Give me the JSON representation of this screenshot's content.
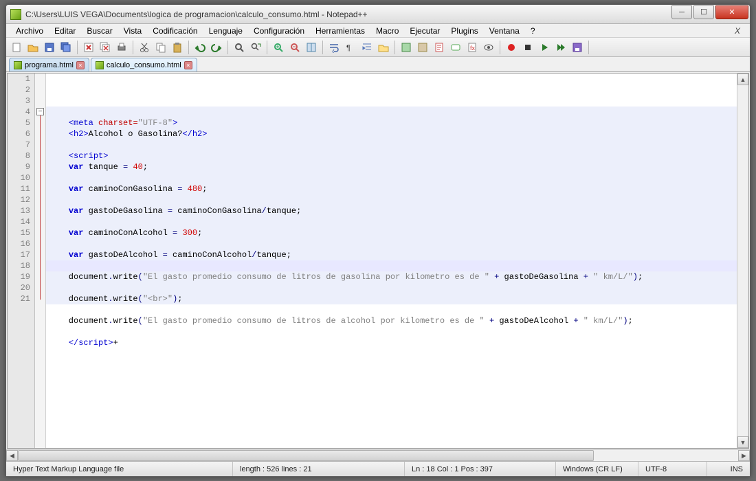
{
  "window": {
    "title": "C:\\Users\\LUIS VEGA\\Documents\\logica de programacion\\calculo_consumo.html - Notepad++"
  },
  "menu": {
    "items": [
      "Archivo",
      "Editar",
      "Buscar",
      "Vista",
      "Codificación",
      "Lenguaje",
      "Configuración",
      "Herramientas",
      "Macro",
      "Ejecutar",
      "Plugins",
      "Ventana",
      "?"
    ],
    "close": "X"
  },
  "tabs": [
    {
      "label": "programa.html"
    },
    {
      "label": "calculo_consumo.html"
    }
  ],
  "code": {
    "lines": [
      {
        "n": 1,
        "segs": [
          [
            "",
            "    "
          ],
          [
            "tag",
            "<meta "
          ],
          [
            "attr",
            "charset="
          ],
          [
            "str",
            "\"UTF-8\""
          ],
          [
            "tag",
            ">"
          ]
        ]
      },
      {
        "n": 2,
        "segs": [
          [
            "",
            "    "
          ],
          [
            "tag",
            "<h2>"
          ],
          [
            "txt",
            "Alcohol o Gasolina?"
          ],
          [
            "tag",
            "</h2>"
          ]
        ]
      },
      {
        "n": 3,
        "segs": [
          [
            "",
            ""
          ]
        ]
      },
      {
        "n": 4,
        "segs": [
          [
            "",
            "    "
          ],
          [
            "tag",
            "<script>"
          ]
        ]
      },
      {
        "n": 5,
        "segs": [
          [
            "",
            "    "
          ],
          [
            "kwvar",
            "var"
          ],
          [
            "",
            " tanque "
          ],
          [
            "op",
            "="
          ],
          [
            "",
            " "
          ],
          [
            "num",
            "40"
          ],
          [
            "txt",
            ";"
          ]
        ]
      },
      {
        "n": 6,
        "segs": [
          [
            "",
            ""
          ]
        ]
      },
      {
        "n": 7,
        "segs": [
          [
            "",
            "    "
          ],
          [
            "kwvar",
            "var"
          ],
          [
            "",
            " caminoConGasolina "
          ],
          [
            "op",
            "="
          ],
          [
            "",
            " "
          ],
          [
            "num",
            "480"
          ],
          [
            "txt",
            ";"
          ]
        ]
      },
      {
        "n": 8,
        "segs": [
          [
            "",
            ""
          ]
        ]
      },
      {
        "n": 9,
        "segs": [
          [
            "",
            "    "
          ],
          [
            "kwvar",
            "var"
          ],
          [
            "",
            " gastoDeGasolina "
          ],
          [
            "op",
            "="
          ],
          [
            "",
            " caminoConGasolina"
          ],
          [
            "op",
            "/"
          ],
          [
            "",
            "tanque"
          ],
          [
            "txt",
            ";"
          ]
        ]
      },
      {
        "n": 10,
        "segs": [
          [
            "",
            ""
          ]
        ]
      },
      {
        "n": 11,
        "segs": [
          [
            "",
            "    "
          ],
          [
            "kwvar",
            "var"
          ],
          [
            "",
            " caminoConAlcohol "
          ],
          [
            "op",
            "="
          ],
          [
            "",
            " "
          ],
          [
            "num",
            "300"
          ],
          [
            "txt",
            ";"
          ]
        ]
      },
      {
        "n": 12,
        "segs": [
          [
            "",
            ""
          ]
        ]
      },
      {
        "n": 13,
        "segs": [
          [
            "",
            "    "
          ],
          [
            "kwvar",
            "var"
          ],
          [
            "",
            " gastoDeAlcohol "
          ],
          [
            "op",
            "="
          ],
          [
            "",
            " caminoConAlcohol"
          ],
          [
            "op",
            "/"
          ],
          [
            "",
            "tanque"
          ],
          [
            "txt",
            ";"
          ]
        ]
      },
      {
        "n": 14,
        "segs": [
          [
            "",
            ""
          ]
        ]
      },
      {
        "n": 15,
        "segs": [
          [
            "",
            "    document"
          ],
          [
            "op",
            "."
          ],
          [
            "",
            "write"
          ],
          [
            "op",
            "("
          ],
          [
            "str",
            "\"El gasto promedio consumo de litros de gasolina por kilometro es de \""
          ],
          [
            "",
            " "
          ],
          [
            "op",
            "+"
          ],
          [
            "",
            " gastoDeGasolina "
          ],
          [
            "op",
            "+"
          ],
          [
            "",
            " "
          ],
          [
            "str",
            "\" km/L/\""
          ],
          [
            "op",
            ")"
          ],
          [
            "txt",
            ";"
          ]
        ]
      },
      {
        "n": 16,
        "segs": [
          [
            "",
            ""
          ]
        ]
      },
      {
        "n": 17,
        "segs": [
          [
            "",
            "    document"
          ],
          [
            "op",
            "."
          ],
          [
            "",
            "write"
          ],
          [
            "op",
            "("
          ],
          [
            "str",
            "\"<br>\""
          ],
          [
            "op",
            ")"
          ],
          [
            "txt",
            ";"
          ]
        ]
      },
      {
        "n": 18,
        "segs": [
          [
            "",
            ""
          ]
        ]
      },
      {
        "n": 19,
        "segs": [
          [
            "",
            "    document"
          ],
          [
            "op",
            "."
          ],
          [
            "",
            "write"
          ],
          [
            "op",
            "("
          ],
          [
            "str",
            "\"El gasto promedio consumo de litros de alcohol por kilometro es de \""
          ],
          [
            "",
            " "
          ],
          [
            "op",
            "+"
          ],
          [
            "",
            " gastoDeAlcohol "
          ],
          [
            "op",
            "+"
          ],
          [
            "",
            " "
          ],
          [
            "str",
            "\" km/L/\""
          ],
          [
            "op",
            ")"
          ],
          [
            "txt",
            ";"
          ]
        ]
      },
      {
        "n": 20,
        "segs": [
          [
            "",
            ""
          ]
        ]
      },
      {
        "n": 21,
        "segs": [
          [
            "",
            "    "
          ],
          [
            "tag",
            "</script>"
          ],
          [
            "txt",
            "+"
          ]
        ]
      }
    ]
  },
  "status": {
    "filetype": "Hyper Text Markup Language file",
    "length": "length : 526    lines : 21",
    "pos": "Ln : 18    Col : 1    Pos : 397",
    "eol": "Windows (CR LF)",
    "enc": "UTF-8",
    "ins": "INS"
  },
  "cursor": {
    "line": 18
  },
  "toolbar": {
    "groups": [
      [
        "new",
        "open",
        "save",
        "saveall"
      ],
      [
        "close",
        "closeall",
        "print"
      ],
      [
        "cut",
        "copy",
        "paste"
      ],
      [
        "undo",
        "redo"
      ],
      [
        "find",
        "replace"
      ],
      [
        "zoomin",
        "zoomout",
        "sync"
      ],
      [
        "wordwrap",
        "allchars",
        "indent",
        "folder"
      ],
      [
        "lang1",
        "lang2",
        "doc",
        "comment",
        "func",
        "eye"
      ],
      [
        "rec",
        "stop",
        "play",
        "playmult",
        "save2"
      ],
      [
        "spacer"
      ]
    ]
  }
}
